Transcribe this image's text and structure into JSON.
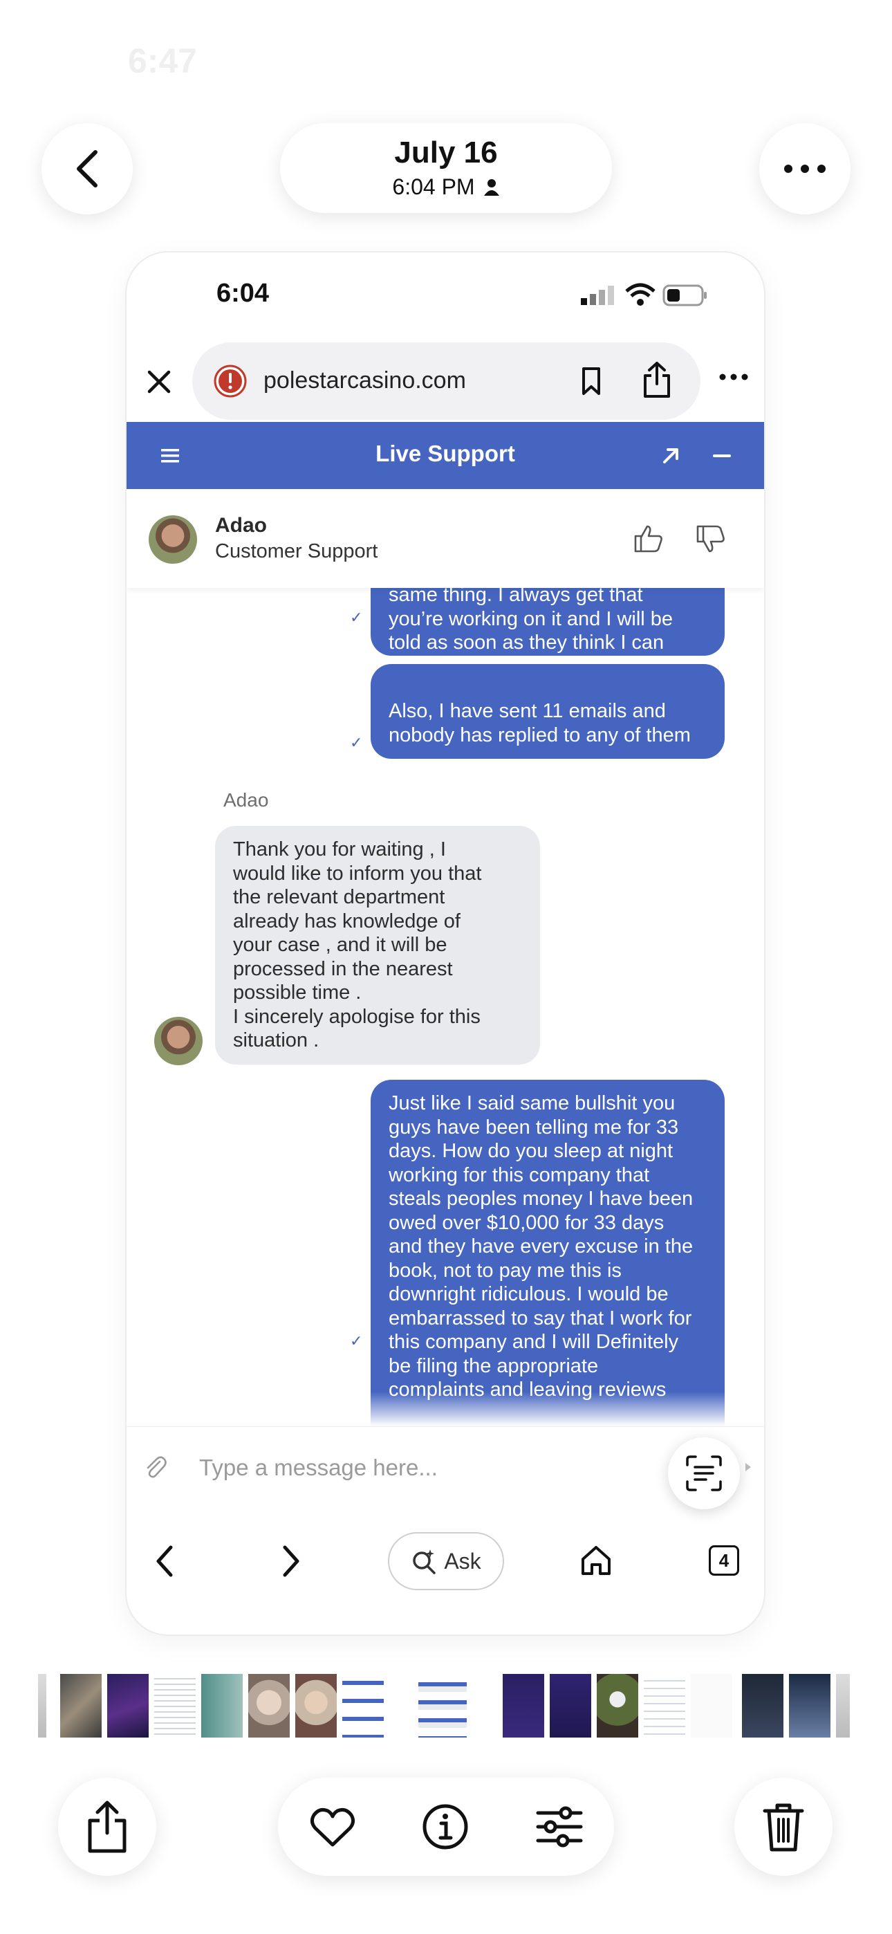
{
  "viewer": {
    "date": "July 16",
    "time": "6:04 PM",
    "ghost_time": "6:47"
  },
  "screenshot": {
    "status_time": "6:04",
    "url": "polestarcasino.com",
    "widget_title": "Live Support",
    "agent": {
      "name": "Adao",
      "role": "Customer Support"
    },
    "messages": [
      {
        "from": "me",
        "text": "same thing. I always get that\nyou’re working on it and I will be\ntold as soon as they think I can\nfigure it out."
      },
      {
        "from": "me",
        "text": "Also, I have sent 11 emails and\nnobody has replied to any of them"
      },
      {
        "from": "agent",
        "sender": "Adao",
        "text": "Thank you for waiting , I\nwould like to inform you that\nthe relevant department\nalready has knowledge of\nyour case , and it will be\nprocessed in the nearest\npossible time .\nI sincerely apologise for this\nsituation ."
      },
      {
        "from": "me",
        "text": "Just like I said same bullshit you\nguys have been telling me for 33\ndays. How do you sleep at night\nworking for this company that\nsteals peoples money I have been\nowed over $10,000 for 33 days\nand they have every excuse in the\nbook, not to pay me this is\ndownright ridiculous. I would be\nembarrassed to say that I work for\nthis company and I will Definitely\nbe filing the appropriate\ncomplaints and leaving reviews"
      }
    ],
    "composer_placeholder": "Type a message here...",
    "ask_label": "Ask",
    "tab_count": "4"
  },
  "colors": {
    "brand_blue": "#4565c0",
    "agent_bubble": "#e9eaee",
    "warning_red": "#c0392b"
  },
  "icons": {
    "viewer": [
      "back-chevron-icon",
      "more-icon",
      "person-icon"
    ],
    "browser": [
      "close-icon",
      "warning-icon",
      "bookmark-icon",
      "share-icon",
      "more-icon",
      "back-icon",
      "forward-icon",
      "ai-search-icon",
      "home-icon",
      "tabs-icon"
    ],
    "widget": [
      "menu-icon",
      "expand-icon",
      "minimize-icon",
      "thumbs-up-icon",
      "thumbs-down-icon",
      "attach-icon",
      "live-text-icon"
    ],
    "toolbar": [
      "share-icon",
      "heart-icon",
      "info-icon",
      "adjust-icon",
      "trash-icon"
    ]
  }
}
